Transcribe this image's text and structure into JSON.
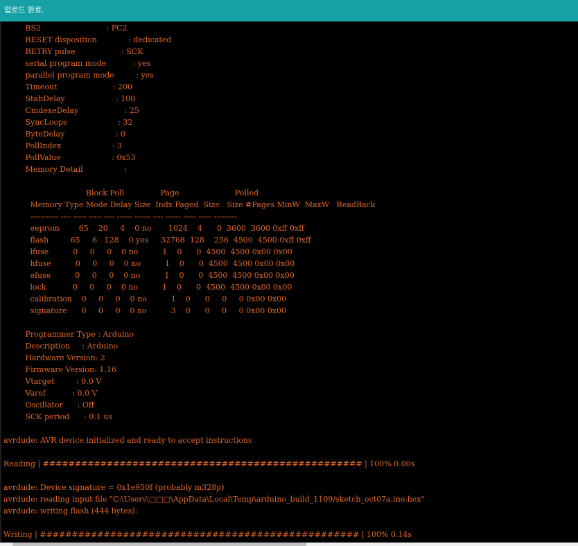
{
  "status_bar": {
    "message": "업로드 완료."
  },
  "console": {
    "text_color": "#e3682a",
    "background": "#000000",
    "lines": [
      "         BS2                           : PC2",
      "         RESET disposition             : dedicated",
      "         RETRY pulse                   : SCK",
      "         serial program mode           : yes",
      "         parallel program mode         : yes",
      "         Timeout                       : 200",
      "         StabDelay                     : 100",
      "         CmdexeDelay                   : 25",
      "         SyncLoops                     : 32",
      "         ByteDelay                     : 0",
      "         PollIndex                     : 3",
      "         PollValue                     : 0x53",
      "         Memory Detail                 :",
      "",
      "                                  Block Poll               Page                       Polled",
      "           Memory Type Mode Delay Size  Indx Paged  Size   Size #Pages MinW  MaxW   ReadBack",
      "           ----------- ---- ----- ----- ---- ------ ------ ---- ------ ----- ----- ---------",
      "           eeprom        65    20     4    0 no       1024    4      0  3600  3600 0xff 0xff",
      "           flash         65     6   128    0 yes     32768  128    256  4500  4500 0xff 0xff",
      "           lfuse          0     0     0    0 no          1    0      0  4500  4500 0x00 0x00",
      "           hfuse          0     0     0    0 no          1    0      0  4500  4500 0x00 0x00",
      "           efuse          0     0     0    0 no          1    0      0  4500  4500 0x00 0x00",
      "           lock           0     0     0    0 no          1    0      0  4500  4500 0x00 0x00",
      "           calibration    0     0     0    0 no          1    0      0     0     0 0x00 0x00",
      "           signature      0     0     0    0 no          3    0      0     0     0 0x00 0x00",
      "",
      "         Programmer Type : Arduino",
      "         Description     : Arduino",
      "         Hardware Version: 2",
      "         Firmware Version: 1.16",
      "         Vtarget         : 0.0 V",
      "         Varef           : 0.0 V",
      "         Oscillator      : Off",
      "         SCK period      : 0.1 us",
      "",
      "avrdude: AVR device initialized and ready to accept instructions",
      "",
      "Reading | ################################################## | 100% 0.00s",
      "",
      "avrdude: Device signature = 0x1e950f (probably m328p)",
      "avrdude: reading input file \"C:\\Users\\□□□\\AppData\\Local\\Temp\\arduino_build_1109/sketch_oct07a.ino.hex\"",
      "avrdude: writing flash (444 bytes):",
      "",
      "Writing | ################################################## | 100% 0.14s"
    ]
  }
}
